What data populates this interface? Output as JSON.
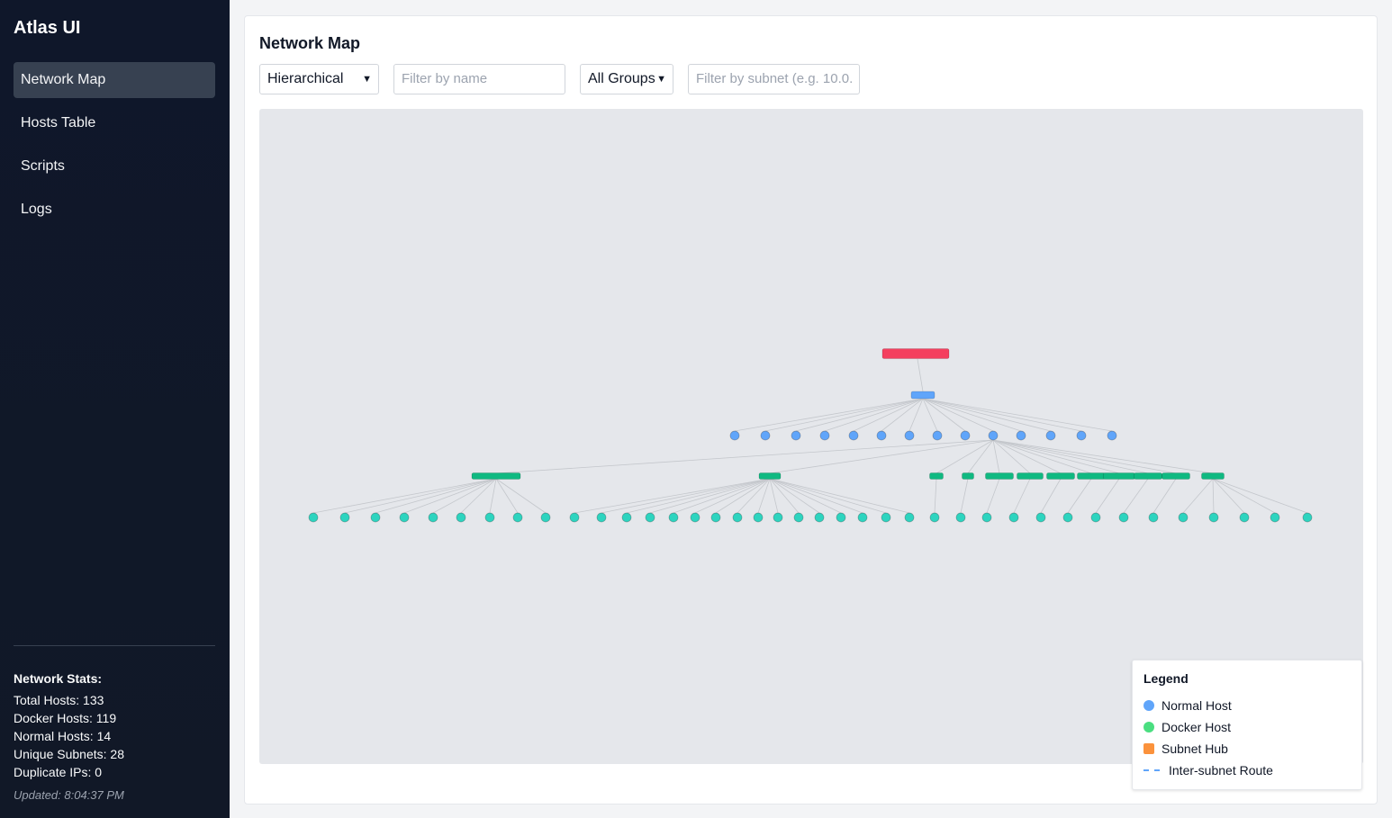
{
  "app": {
    "title": "Atlas UI"
  },
  "sidebar": {
    "items": [
      {
        "label": "Network Map",
        "active": true
      },
      {
        "label": "Hosts Table",
        "active": false
      },
      {
        "label": "Scripts",
        "active": false
      },
      {
        "label": "Logs",
        "active": false
      }
    ],
    "stats": {
      "title": "Network Stats:",
      "total_hosts": "Total Hosts: 133",
      "docker_hosts": "Docker Hosts: 119",
      "normal_hosts": "Normal Hosts: 14",
      "unique_subnets": "Unique Subnets: 28",
      "duplicate_ips": "Duplicate IPs: 0"
    },
    "updated": "Updated: 8:04:37 PM"
  },
  "main": {
    "title": "Network Map",
    "layout_select": {
      "value": "Hierarchical"
    },
    "name_filter": {
      "placeholder": "Filter by name"
    },
    "group_select": {
      "value": "All Groups"
    },
    "subnet_filter": {
      "placeholder": "Filter by subnet (e.g. 10.0."
    }
  },
  "legend": {
    "title": "Legend",
    "items": [
      {
        "label": "Normal Host",
        "color": "#60a5fa",
        "shape": "dot"
      },
      {
        "label": "Docker Host",
        "color": "#4ade80",
        "shape": "dot"
      },
      {
        "label": "Subnet Hub",
        "color": "#fb923c",
        "shape": "square"
      },
      {
        "label": "Inter-subnet Route",
        "color": "#60a5fa",
        "shape": "dash"
      }
    ]
  },
  "colors": {
    "gateway": "#f43f5e",
    "router": "#60a5fa",
    "normal_host": "#60a5fa",
    "docker_hub": "#10b981",
    "docker_host": "#2dd4bf",
    "edge": "#c4c7cc"
  }
}
